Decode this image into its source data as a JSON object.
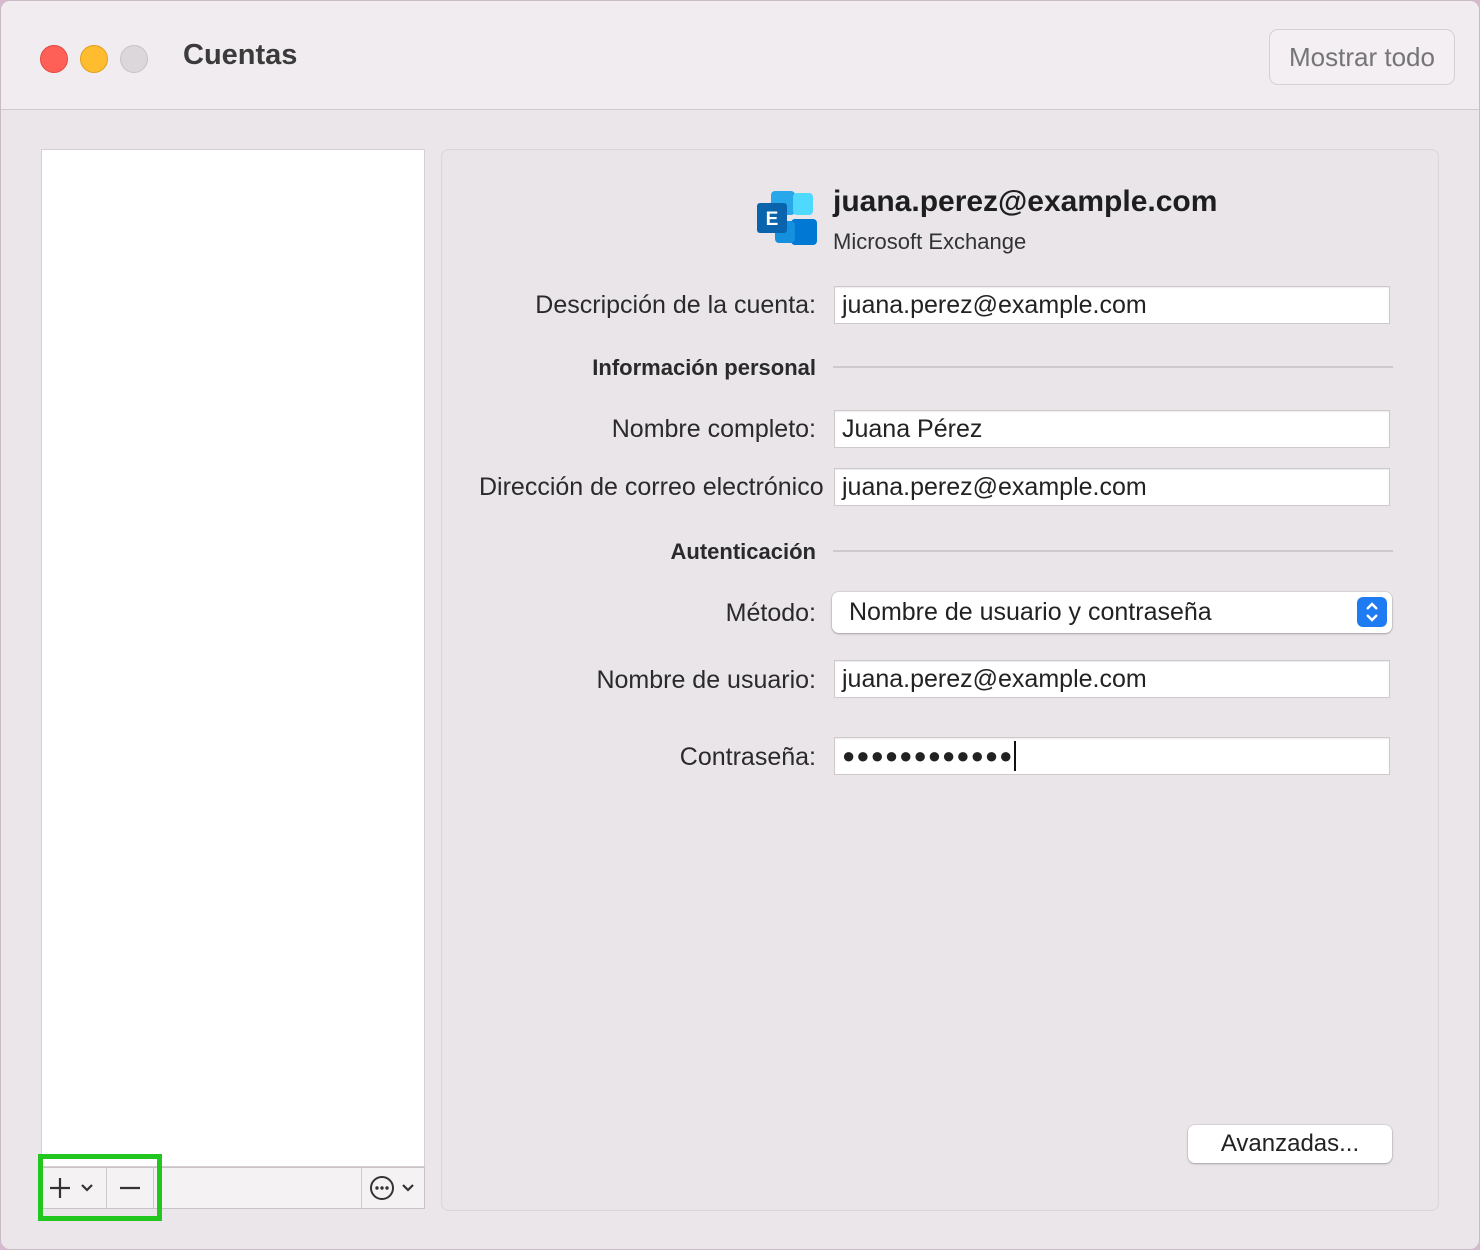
{
  "window": {
    "title": "Cuentas",
    "show_all_label": "Mostrar todo"
  },
  "account": {
    "email": "juana.perez@example.com",
    "type": "Microsoft Exchange",
    "icon": "exchange-icon",
    "icon_letter": "E"
  },
  "form": {
    "description_label": "Descripción de la cuenta:",
    "description_value": "juana.perez@example.com",
    "personal_section": "Información personal",
    "fullname_label": "Nombre completo:",
    "fullname_value": "Juana Pérez",
    "email_label": "Dirección de correo electrónico:",
    "email_value": "juana.perez@example.com",
    "auth_section": "Autenticación",
    "method_label": "Método:",
    "method_value": "Nombre de usuario y contraseña",
    "username_label": "Nombre de usuario:",
    "username_value": "juana.perez@example.com",
    "password_label": "Contraseña:",
    "password_value": "●●●●●●●●●●●●"
  },
  "buttons": {
    "advanced_label": "Avanzadas..."
  },
  "sidebar_toolbar": {
    "add_icon": "plus-icon",
    "remove_icon": "minus-icon",
    "more_icon": "ellipsis-circle-icon"
  },
  "colors": {
    "highlight": "#21c71f",
    "accent": "#1f7bf2"
  }
}
